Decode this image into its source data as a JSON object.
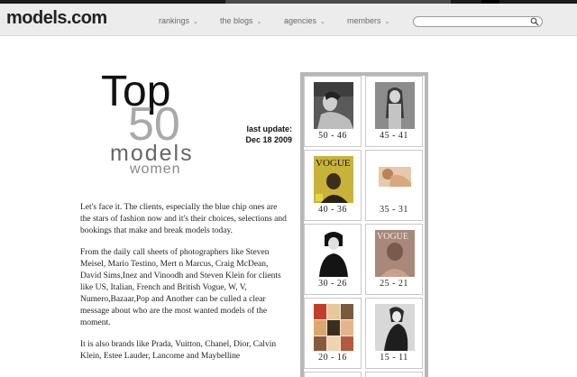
{
  "site": {
    "logo_text": "models",
    "logo_suffix": ".com"
  },
  "nav": {
    "items": [
      {
        "label": "rankings",
        "name": "nav-rankings"
      },
      {
        "label": "the blogs",
        "name": "nav-the-blogs"
      },
      {
        "label": "agencies",
        "name": "nav-agencies"
      },
      {
        "label": "members",
        "name": "nav-members"
      }
    ],
    "chevron": "⌄",
    "search": {
      "value": "",
      "placeholder": "",
      "icon": "search-icon"
    }
  },
  "headline": {
    "line1": "Top",
    "line2": "50",
    "line3": "models",
    "line4": "women"
  },
  "update": {
    "label": "last update:",
    "date": "Dec 18 2009"
  },
  "article": {
    "paragraphs": [
      "Let's face it. The clients, especially the blue chip ones are the stars of fashion now and it's their choices, selections and bookings that make and break models today.",
      "From the daily call sheets of photographers like Steven Meisel, Mario Testino, Mert n Marcus, Craig McDean, David Sims,Inez and Vinoodh and Steven Klein for clients like US, Italian, French and British Vogue, W, V, Numero,Bazaar,Pop and Another can be culled a clear message about who are the most wanted models of the moment.",
      "It is also brands like Prada, Vuitton, Chanel, Dior, Calvin Klein, Estee Lauder, Lancome and Maybelline"
    ]
  },
  "ranking_grid": {
    "cells": [
      {
        "range": "50 - 46",
        "thumb": "portrait-bw-reclining"
      },
      {
        "range": "45 - 41",
        "thumb": "portrait-bw-standing"
      },
      {
        "range": "40 - 36",
        "thumb": "vogue-cover-yellow"
      },
      {
        "range": "35 - 31",
        "thumb": "portrait-color-lying"
      },
      {
        "range": "30 - 26",
        "thumb": "portrait-bw-bob"
      },
      {
        "range": "25 - 21",
        "thumb": "vogue-cover-sepia"
      },
      {
        "range": "20 - 16",
        "thumb": "collage-color"
      },
      {
        "range": "15 - 11",
        "thumb": "portrait-bw-seated"
      }
    ],
    "colors": {
      "frame": "#b8b8b8",
      "cell_border": "#c8c8c8"
    }
  }
}
